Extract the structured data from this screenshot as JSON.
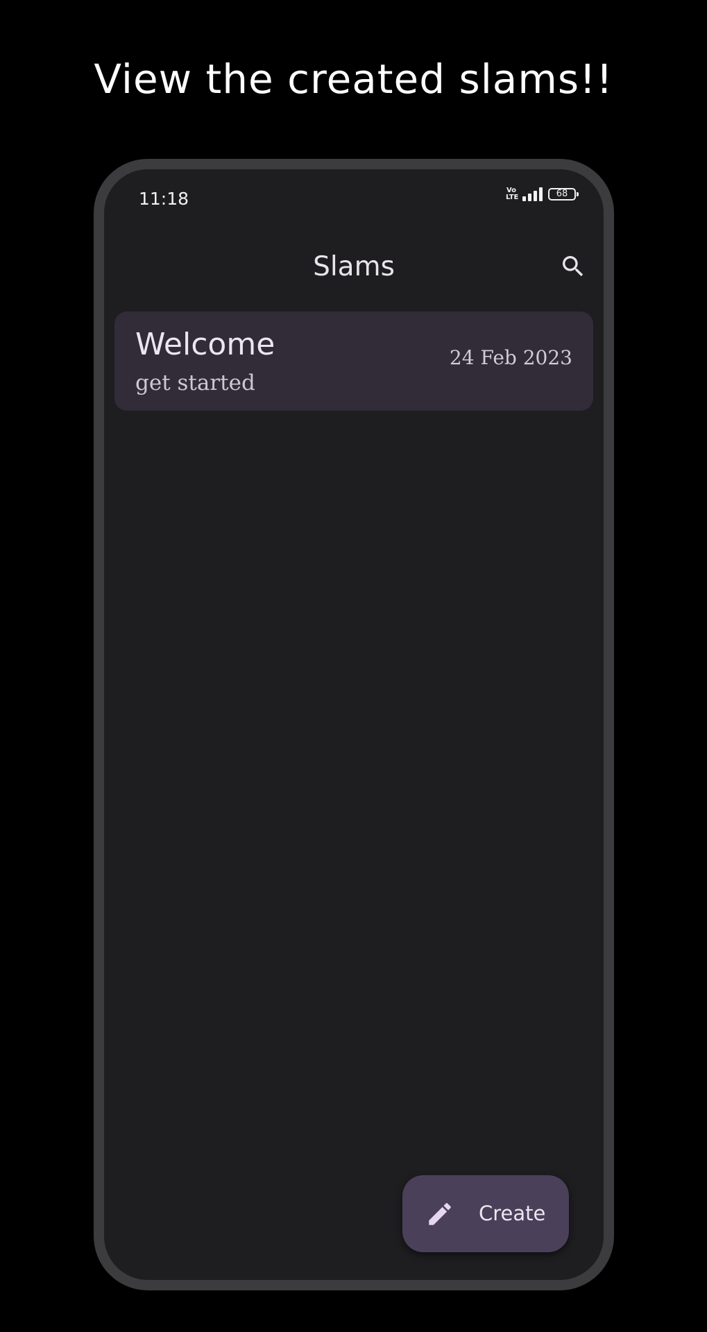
{
  "headline": "View the created slams!!",
  "status_bar": {
    "time": "11:18",
    "network_label": "Vo LTE",
    "battery_level": "68"
  },
  "app_bar": {
    "title": "Slams",
    "search_icon": "search-icon"
  },
  "slams": [
    {
      "title": "Welcome",
      "subtitle": "get started",
      "date": "24 Feb 2023"
    }
  ],
  "fab": {
    "label": "Create",
    "icon": "pencil-icon"
  },
  "colors": {
    "page_background": "#000000",
    "screen_background": "#1e1d20",
    "card_background": "#312c38",
    "fab_background": "#4b4059",
    "frame": "#3c3c3e"
  }
}
